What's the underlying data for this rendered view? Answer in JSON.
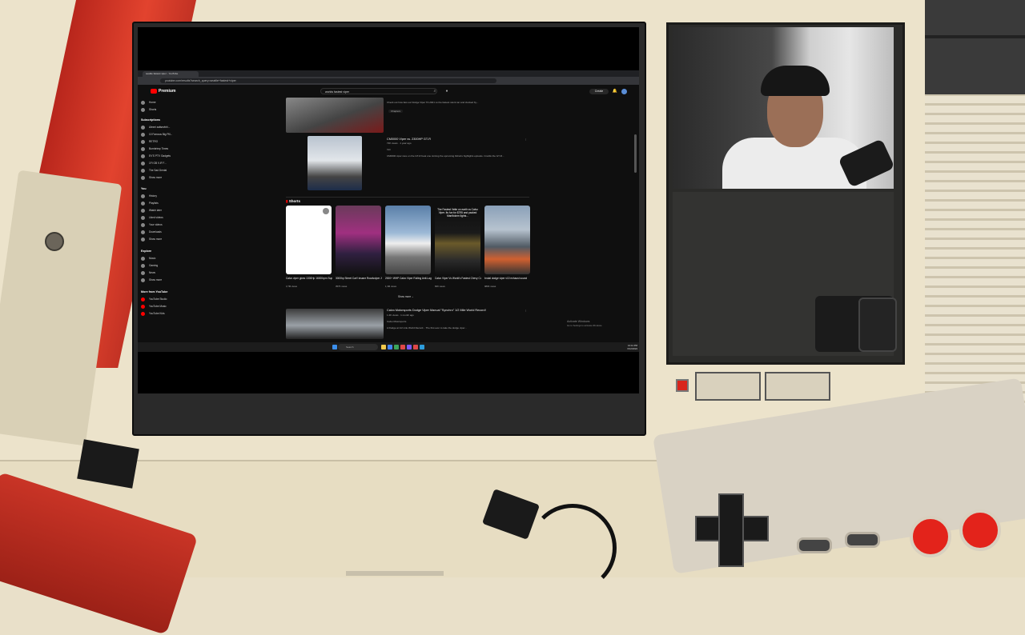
{
  "browser": {
    "tab_title": "seattle fastest viper - YouTube",
    "url": "youtube.com/results?search_query=seattle+fastest+viper"
  },
  "youtube": {
    "logo": "Premium",
    "search_value": "worlds fastest viper",
    "create_label": "Create",
    "sidebar": {
      "top": [
        "Home",
        "Shorts"
      ],
      "subscriptions_header": "Subscriptions",
      "subscriptions": [
        "Alexei zaitsevbhl...",
        "10 Famous Big Pill...",
        "RETRO",
        "Burnbrimp Times",
        "EV'S PTV Gadgets",
        "1FI GB V.IF F...",
        "The Sad Dental",
        "Show more"
      ],
      "you_header": "You",
      "you": [
        "History",
        "Playlists",
        "Watch later",
        "Liked videos",
        "Your videos",
        "Downloads",
        "Show more"
      ],
      "explore_header": "Explore",
      "explore": [
        "Music",
        "Gaming",
        "News",
        "Show more"
      ],
      "more_header": "More from YouTube",
      "more": [
        "YouTube Studio",
        "YouTube Music",
        "YouTube Kids"
      ]
    },
    "results": [
      {
        "title": "CM0000 Viper vs. 2300HP GT-R",
        "meta": "72K views · 1 year ago",
        "channel": "Vici",
        "desc": "CM0000 viper race on the GT-R beat one Joining the upcoming #shorts highlights episode. Credits the GT-R..."
      },
      {
        "title": "Calvo Motorsports Dodge Viper Manual \"Synchro\" 1/2 Mile World Record!",
        "meta": "1.2K views · 1 month ago",
        "channel": "Calvo Motorsports",
        "desc": "A Dodge at 1/2 mile World Record... The first ever to take the dodge viper..."
      }
    ],
    "top_snippet": "Check out how fast our Dodge Viper TA 2021 vs the fastest stock car and clocked by...",
    "chapters_label": "Chapters",
    "shorts_header": "Shorts",
    "shorts": [
      {
        "title": "Calvo viper gives 1300Hp 16000rpm Supra the hit",
        "views": "3,7M views",
        "overlay": ""
      },
      {
        "title": "3000hp Street Car!! insane Roadvolper Jviper ...",
        "views": "357K views",
        "overlay": ""
      },
      {
        "title": "2000+ WHP Calvo Viper Rolling Anti-Lag",
        "views": "1,3M views",
        "overlay": ""
      },
      {
        "title": "Calvo Viper Vs World's Fastest Chevy Corvette...",
        "views": "66K views",
        "overlay": "The Fastest Vette on earth vs Calvo Viper. Its fun for $795 and packed Manifolorm lights..."
      },
      {
        "title": "brutal dodge viper v10 exhaust sound",
        "views": "980K views",
        "overlay": ""
      }
    ],
    "show_more": "Show more",
    "activate_windows": [
      "Activate Windows",
      "Go to Settings to activate Windows."
    ],
    "taskbar_search": "Search",
    "clock": [
      "10:41 PM",
      "6/12/2024"
    ]
  },
  "colors": {
    "youtube_red": "#ff0000",
    "nes_red": "#e2432e",
    "nes_cream": "#ece3cb"
  }
}
